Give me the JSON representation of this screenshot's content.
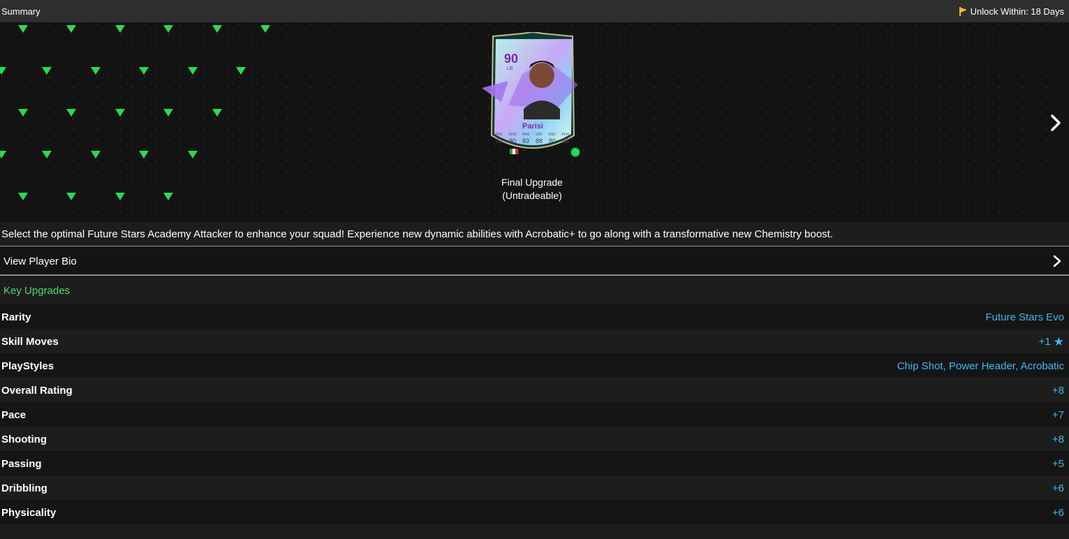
{
  "header": {
    "title": "Summary",
    "unlock_text": "Unlock Within: 18 Days",
    "unlock_icon": "yellow-flag-icon",
    "accent_color": "#f5b82e"
  },
  "card": {
    "rating": "90",
    "position": "LB",
    "name": "Parisi",
    "stat_labels": [
      "PAC",
      "SHO",
      "PAS",
      "DRI",
      "DEF",
      "PHY"
    ],
    "stat_values": [
      "92",
      "80",
      "83",
      "88",
      "80",
      "86"
    ],
    "caption_line1": "Final Upgrade",
    "caption_line2": "(Untradeable)"
  },
  "description": "Select the optimal Future Stars Academy Attacker to enhance your squad! Experience new dynamic abilities with Acrobatic+ to go along with a transformative new Chemistry boost.",
  "bio": {
    "label": "View Player Bio"
  },
  "upgrades": {
    "header": "Key Upgrades",
    "header_color": "#4ddd6a",
    "value_color": "#3fb8f0",
    "rows": [
      {
        "label": "Rarity",
        "value": "Future Stars Evo"
      },
      {
        "label": "Skill Moves",
        "value": "+1",
        "icon": "star-icon"
      },
      {
        "label": "PlayStyles",
        "value": "Chip Shot, Power Header, Acrobatic"
      },
      {
        "label": "Overall Rating",
        "value": "+8"
      },
      {
        "label": "Pace",
        "value": "+7"
      },
      {
        "label": "Shooting",
        "value": "+8"
      },
      {
        "label": "Passing",
        "value": "+5"
      },
      {
        "label": "Dribbling",
        "value": "+6"
      },
      {
        "label": "Physicality",
        "value": "+6"
      }
    ]
  }
}
